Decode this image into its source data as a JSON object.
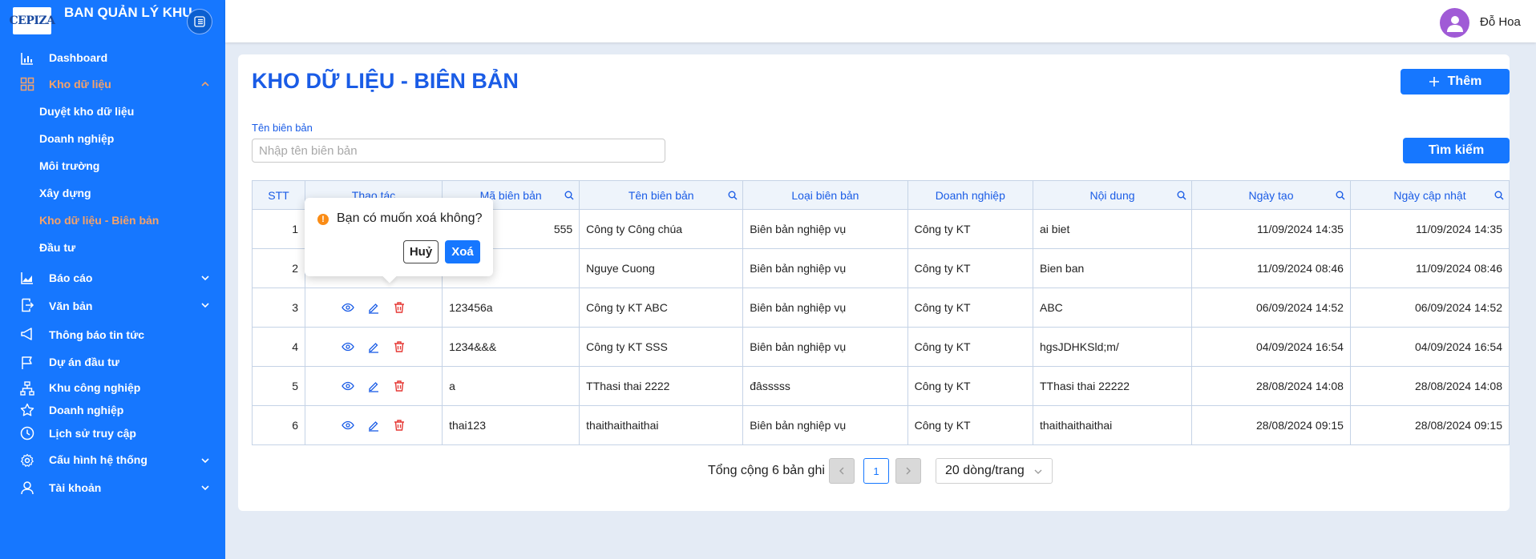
{
  "brand": {
    "logo_text": "CEPIZA",
    "title": "BAN QUẢN LÝ KHU CHẾ XUẤT KHU CN"
  },
  "sidebar": {
    "items": [
      {
        "label": "Dashboard",
        "icon": "bar-chart-icon"
      },
      {
        "label": "Kho dữ liệu",
        "icon": "grid-icon",
        "expanded": true
      },
      {
        "label": "Báo cáo",
        "icon": "area-chart-icon"
      },
      {
        "label": "Văn bản",
        "icon": "document-icon"
      },
      {
        "label": "Thông báo tin tức",
        "icon": "megaphone-icon"
      },
      {
        "label": "Dự án đầu tư",
        "icon": "flag-icon"
      },
      {
        "label": "Khu công nghiệp",
        "icon": "org-chart-icon"
      },
      {
        "label": "Doanh nghiệp",
        "icon": "star-icon"
      },
      {
        "label": "Lịch sử truy cập",
        "icon": "clock-icon"
      },
      {
        "label": "Cấu hình hệ thống",
        "icon": "gear-icon"
      },
      {
        "label": "Tài khoản",
        "icon": "user-icon"
      }
    ],
    "kho_sub": [
      "Duyệt kho dữ liệu",
      "Doanh nghiệp",
      "Môi trường",
      "Xây dựng",
      "Kho dữ liệu - Biên bản",
      "Đầu tư"
    ]
  },
  "user": {
    "name": "Đỗ Hoa"
  },
  "page": {
    "title": "KHO DỮ LIỆU - BIÊN BẢN",
    "add_label": "Thêm",
    "search_label": "Tên biên bản",
    "search_placeholder": "Nhập tên biên bản",
    "search_button": "Tìm kiếm"
  },
  "table": {
    "headers": [
      "STT",
      "Thao tác",
      "Mã biên bản",
      "Tên biên bản",
      "Loại biên bản",
      "Doanh nghiệp",
      "Nội dung",
      "Ngày tạo",
      "Ngày cập nhật"
    ],
    "rows": [
      {
        "stt": "1",
        "ma": "555",
        "ten": "Công ty Công chúa",
        "loai": "Biên bản nghiệp vụ",
        "dn": "Công ty KT",
        "noidung": "ai biet",
        "ngaytao": "11/09/2024 14:35",
        "ngaycapnhat": "11/09/2024 14:35"
      },
      {
        "stt": "2",
        "ma": "",
        "ten": "Nguye Cuong",
        "loai": "Biên bản nghiệp vụ",
        "dn": "Công ty KT",
        "noidung": "Bien ban",
        "ngaytao": "11/09/2024 08:46",
        "ngaycapnhat": "11/09/2024 08:46"
      },
      {
        "stt": "3",
        "ma": "123456a",
        "ten": "Công ty KT ABC",
        "loai": "Biên bản nghiệp vụ",
        "dn": "Công ty KT",
        "noidung": "ABC",
        "ngaytao": "06/09/2024 14:52",
        "ngaycapnhat": "06/09/2024 14:52"
      },
      {
        "stt": "4",
        "ma": "1234&&&",
        "ten": "Công ty KT SSS",
        "loai": "Biên bản nghiệp vụ",
        "dn": "Công ty KT",
        "noidung": "hgsJDHKSld;m/",
        "ngaytao": "04/09/2024 16:54",
        "ngaycapnhat": "04/09/2024 16:54"
      },
      {
        "stt": "5",
        "ma": "a",
        "ten": "TThasi thai 2222",
        "loai": "đâsssss",
        "dn": "Công ty KT",
        "noidung": "TThasi thai 22222",
        "ngaytao": "28/08/2024 14:08",
        "ngaycapnhat": "28/08/2024 14:08"
      },
      {
        "stt": "6",
        "ma": "thai123",
        "ten": "thaithaithaithai",
        "loai": "Biên bản nghiệp vụ",
        "dn": "Công ty KT",
        "noidung": "thaithaithaithai",
        "ngaytao": "28/08/2024 09:15",
        "ngaycapnhat": "28/08/2024 09:15"
      }
    ]
  },
  "popconfirm": {
    "message": "Bạn có muốn xoá không?",
    "cancel": "Huỷ",
    "confirm": "Xoá"
  },
  "pagination": {
    "total_text": "Tổng cộng 6 bản ghi",
    "current_page": "1",
    "page_size": "20 dòng/trang"
  },
  "colors": {
    "sidebar": "#1677ff",
    "accent": "#1a5ce6",
    "active_menu": "#f5a26a",
    "delete": "#e53935"
  }
}
